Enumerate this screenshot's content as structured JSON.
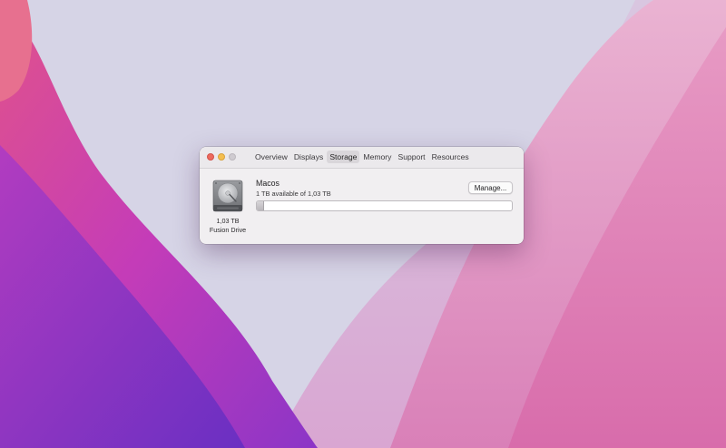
{
  "window": {
    "tabs": [
      {
        "label": "Overview"
      },
      {
        "label": "Displays"
      },
      {
        "label": "Storage",
        "active": true
      },
      {
        "label": "Memory"
      },
      {
        "label": "Support"
      },
      {
        "label": "Resources"
      }
    ]
  },
  "disk": {
    "icon": "hard-drive-icon",
    "capacity": "1,03 TB",
    "type": "Fusion Drive"
  },
  "volume": {
    "name": "Macos",
    "availability": "1 TB available of 1,03 TB",
    "used_fraction": 0.025,
    "manage_label": "Manage..."
  },
  "colors": {
    "close": "#ed6a5e",
    "minimize": "#f5bf4f",
    "zoom_inactive": "#cfcbd0",
    "selected_tab": "#d9d6da"
  }
}
